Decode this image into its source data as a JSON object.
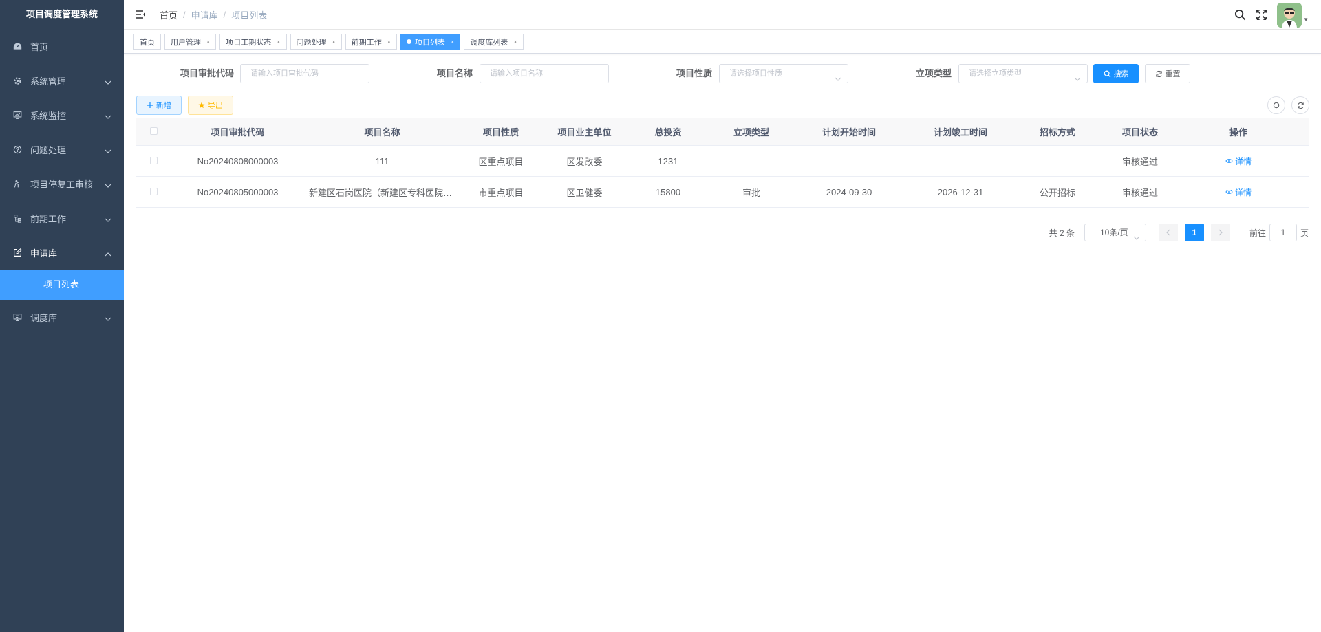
{
  "app": {
    "title": "项目调度管理系统"
  },
  "sidebar": {
    "items": [
      {
        "label": "首页",
        "icon": "dashboard-icon"
      },
      {
        "label": "系统管理",
        "icon": "system-gear-icon"
      },
      {
        "label": "系统监控",
        "icon": "monitor-icon"
      },
      {
        "label": "问题处理",
        "icon": "question-icon"
      },
      {
        "label": "项目停复工审核",
        "icon": "audit-icon"
      },
      {
        "label": "前期工作",
        "icon": "tree-icon"
      },
      {
        "label": "申请库",
        "icon": "edit-icon"
      },
      {
        "label": "调度库",
        "icon": "dispatch-icon"
      }
    ],
    "submenu": {
      "label": "项目列表"
    }
  },
  "breadcrumb": {
    "home": "首页",
    "level1": "申请库",
    "level2": "项目列表"
  },
  "tags": [
    {
      "label": "首页"
    },
    {
      "label": "用户管理"
    },
    {
      "label": "项目工期状态"
    },
    {
      "label": "问题处理"
    },
    {
      "label": "前期工作"
    },
    {
      "label": "项目列表"
    },
    {
      "label": "调度库列表"
    }
  ],
  "search": {
    "code_label": "项目审批代码",
    "code_placeholder": "请输入项目审批代码",
    "name_label": "项目名称",
    "name_placeholder": "请输入项目名称",
    "nature_label": "项目性质",
    "nature_placeholder": "请选择项目性质",
    "type_label": "立项类型",
    "type_placeholder": "请选择立项类型",
    "search_btn": "搜索",
    "reset_btn": "重置"
  },
  "toolbar": {
    "add_btn": "新增",
    "export_btn": "导出"
  },
  "table": {
    "headers": [
      "项目审批代码",
      "项目名称",
      "项目性质",
      "项目业主单位",
      "总投资",
      "立项类型",
      "计划开始时间",
      "计划竣工时间",
      "招标方式",
      "项目状态",
      "操作"
    ],
    "rows": [
      [
        "No20240808000003",
        "111",
        "区重点项目",
        "区发改委",
        "1231",
        "",
        "",
        "",
        "",
        "审核通过",
        "详情"
      ],
      [
        "No20240805000003",
        "新建区石岗医院（新建区专科医院）...",
        "市重点项目",
        "区卫健委",
        "15800",
        "审批",
        "2024-09-30",
        "2026-12-31",
        "公开招标",
        "审核通过",
        "详情"
      ]
    ]
  },
  "pagination": {
    "total": "共 2 条",
    "page_size": "10条/页",
    "current": "1",
    "goto_prefix": "前往",
    "goto_value": "1",
    "goto_suffix": "页"
  },
  "colors": {
    "sidebar_bg": "#304156",
    "primary": "#1890ff",
    "active_menu": "#409eff"
  }
}
